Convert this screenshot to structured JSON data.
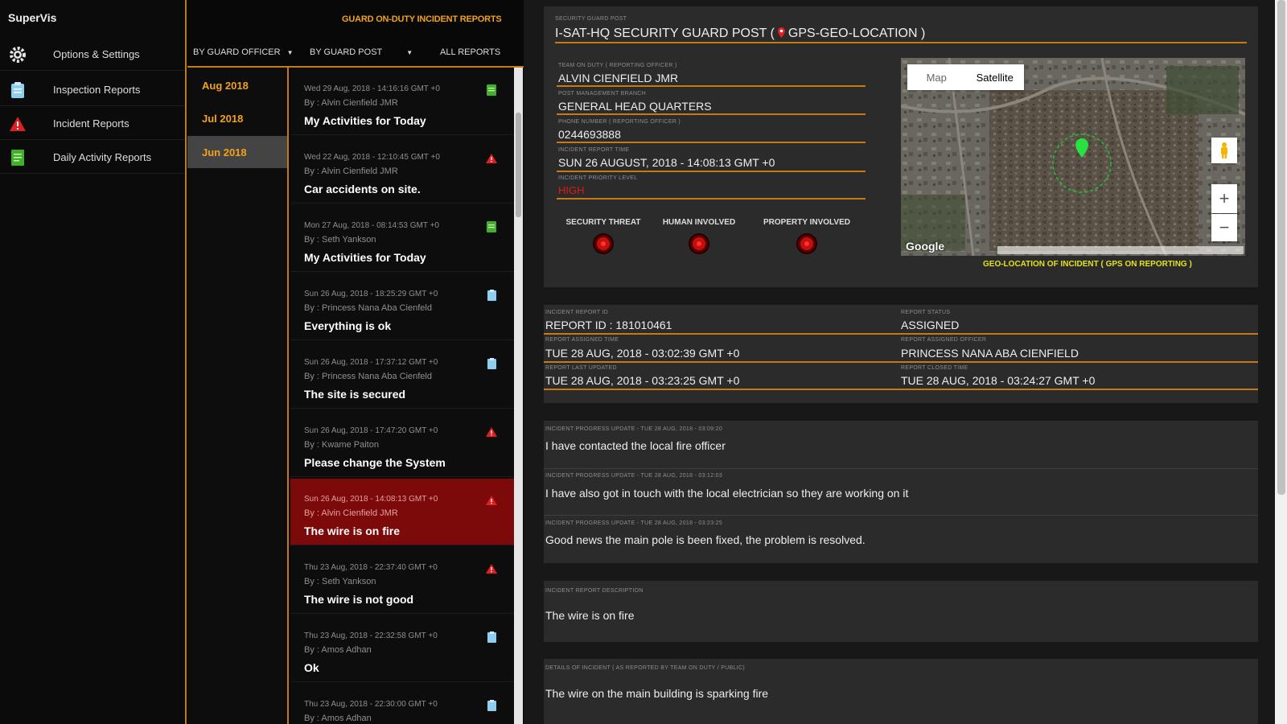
{
  "app": {
    "brand": "SuperVis"
  },
  "nav": {
    "items": [
      {
        "label": "Options & Settings",
        "icon": "gear-icon"
      },
      {
        "label": "Inspection Reports",
        "icon": "clipboard-icon"
      },
      {
        "label": "Incident Reports",
        "icon": "warning-icon"
      },
      {
        "label": "Daily Activity Reports",
        "icon": "document-icon"
      }
    ]
  },
  "middle": {
    "title": "GUARD ON-DUTY INCIDENT REPORTS",
    "filters": {
      "by_officer": "BY GUARD OFFICER",
      "by_post": "BY GUARD POST",
      "all": "ALL REPORTS"
    },
    "months": [
      "Aug 2018",
      "Jul 2018",
      "Jun 2018"
    ],
    "selected_month": "Jun 2018",
    "reports": [
      {
        "meta": "Wed 29 Aug, 2018 - 14:16:16 GMT +0",
        "by": "By : Alvin Cienfield JMR",
        "title": "My Activities for Today",
        "icon": "activity-report-icon"
      },
      {
        "meta": "Wed 22 Aug, 2018 - 12:10:45 GMT +0",
        "by": "By : Alvin Cienfield JMR",
        "title": "Car accidents on site.",
        "icon": "incident-warning-icon"
      },
      {
        "meta": "Mon 27 Aug, 2018 - 08:14:53 GMT +0",
        "by": "By : Seth Yankson",
        "title": "My Activities for Today",
        "icon": "activity-report-icon"
      },
      {
        "meta": "Sun 26 Aug, 2018 - 18:25:29 GMT +0",
        "by": "By : Princess Nana Aba Cienfeld",
        "title": "Everything is ok",
        "icon": "inspection-report-icon"
      },
      {
        "meta": "Sun 26 Aug, 2018 - 17:37:12 GMT +0",
        "by": "By : Princess Nana Aba Cienfeld",
        "title": "The site is secured",
        "icon": "inspection-report-icon"
      },
      {
        "meta": "Sun 26 Aug, 2018 - 17:47:20 GMT +0",
        "by": "By : Kwame Paiton",
        "title": "Please change the System",
        "icon": "incident-warning-icon"
      },
      {
        "meta": "Sun 26 Aug, 2018 - 14:08:13 GMT +0",
        "by": "By : Alvin Cienfield JMR",
        "title": "The wire is on fire",
        "icon": "incident-warning-icon",
        "selected": true
      },
      {
        "meta": "Thu 23 Aug, 2018 - 22:37:40 GMT +0",
        "by": "By : Seth Yankson",
        "title": "The wire is not good",
        "icon": "incident-warning-icon"
      },
      {
        "meta": "Thu 23 Aug, 2018 - 22:32:58 GMT +0",
        "by": "By : Amos Adhan",
        "title": "Ok",
        "icon": "inspection-report-icon"
      },
      {
        "meta": "Thu 23 Aug, 2018 - 22:30:00 GMT +0",
        "by": "By : Amos Adhan",
        "title": "",
        "icon": "inspection-report-icon"
      }
    ]
  },
  "detail": {
    "post_label": "SECURITY GUARD POST",
    "post_title": "I-SAT-HQ SECURITY GUARD POST (",
    "post_title_suffix": "GPS-GEO-LOCATION )",
    "fields": [
      {
        "label": "TEAM ON DUTY ( REPORTING OFFICER )",
        "value": "ALVIN CIENFIELD JMR"
      },
      {
        "label": "POST MANAGEMENT BRANCH",
        "value": "GENERAL HEAD QUARTERS"
      },
      {
        "label": "PHONE NUMBER ( REPORTING OFFICER )",
        "value": "0244693888"
      },
      {
        "label": "INCIDENT REPORT TIME",
        "value": "SUN 26 AUGUST, 2018 - 14:08:13 GMT +0"
      },
      {
        "label": "INCIDENT PRIORITY LEVEL",
        "value": "HIGH"
      }
    ],
    "indicators": [
      {
        "label": "SECURITY THREAT"
      },
      {
        "label": "HUMAN INVOLVED"
      },
      {
        "label": "PROPERTY INVOLVED"
      }
    ],
    "map": {
      "tab_map": "Map",
      "tab_satellite": "Satellite",
      "google": "Google",
      "caption": "GEO-LOCATION OF INCIDENT ( GPS ON REPORTING )"
    },
    "report_info": {
      "left": [
        {
          "label": "INCIDENT REPORT ID",
          "value": "REPORT ID : 181010461"
        },
        {
          "label": "REPORT ASSIGNED TIME",
          "value": "TUE 28 AUG, 2018 - 03:02:39 GMT +0"
        },
        {
          "label": "REPORT LAST UPDATED",
          "value": "TUE 28 AUG, 2018 - 03:23:25 GMT +0"
        }
      ],
      "right": [
        {
          "label": "REPORT STATUS",
          "value": "ASSIGNED"
        },
        {
          "label": "REPORT ASSIGNED OFFICER",
          "value": "PRINCESS NANA ABA CIENFIELD"
        },
        {
          "label": "REPORT CLOSED TIME",
          "value": "TUE 28 AUG, 2018 - 03:24:27 GMT +0"
        }
      ]
    },
    "updates": [
      {
        "label": "INCIDENT PROGRESS UPDATE - TUE 28 AUG, 2018 - 03:09:20",
        "text": "I have contacted the local fire officer"
      },
      {
        "label": "INCIDENT PROGRESS UPDATE - TUE 28 AUG, 2018 - 03:12:03",
        "text": "I have also got in touch with the local electrician so they are working on it"
      },
      {
        "label": "INCIDENT PROGRESS UPDATE - TUE 28 AUG, 2018 - 03:23:25",
        "text": "Good news the main pole is been fixed, the problem is resolved."
      }
    ],
    "description": {
      "label": "INCIDENT REPORT DESCRIPTION",
      "text": "The wire is on fire"
    },
    "details": {
      "label": "DETAILS OF INCIDENT ( AS REPORTED BY TEAM ON DUTY / PUBLIC)",
      "text": "The wire on the main building is sparking fire"
    }
  },
  "colors": {
    "accent": "#c67a14",
    "month": "#f2a21a",
    "selected_row": "#7d0a0a",
    "priority_high": "#e01818",
    "caption": "#e3e31a"
  }
}
